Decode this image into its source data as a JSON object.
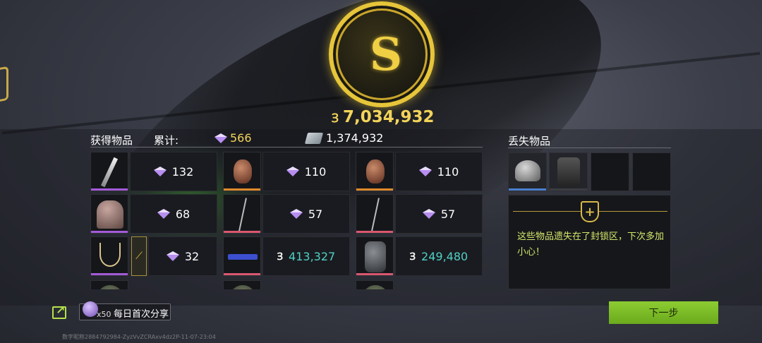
{
  "reward": {
    "currency_icon": "coin-currency-icon",
    "coin_mark": "S",
    "total": "7,034,932",
    "currency_symbol": "Ɜ"
  },
  "obtained": {
    "title": "获得物品",
    "cumulative_label": "累计:",
    "gem_total": "566",
    "cash_total": "1,374,932",
    "items": [
      {
        "icon": "knife-icon",
        "value": "132",
        "kind": "gem",
        "rarity": "#a35ad8"
      },
      {
        "icon": "jug-icon",
        "value": "110",
        "kind": "gem",
        "rarity": "#e08a2a"
      },
      {
        "icon": "jug-icon",
        "value": "110",
        "kind": "gem",
        "rarity": "#e08a2a"
      },
      {
        "icon": "statue-icon",
        "value": "68",
        "kind": "gem",
        "rarity": "#a35ad8"
      },
      {
        "icon": "rod-icon",
        "value": "57",
        "kind": "gem",
        "rarity": "#d8576e"
      },
      {
        "icon": "rod-icon",
        "value": "57",
        "kind": "gem",
        "rarity": "#d8576e"
      },
      {
        "icon": "necklace-icon",
        "value": "32",
        "kind": "gem",
        "rarity": "#a35ad8"
      },
      {
        "icon": "rifle-icon",
        "value": "413,327",
        "kind": "cash",
        "rarity": "#d8576e"
      },
      {
        "icon": "backpack-icon",
        "value": "249,480",
        "kind": "cash",
        "rarity": "#d8576e"
      }
    ]
  },
  "lost": {
    "title": "丢失物品",
    "message": "这些物品遗失在了封锁区，下次多加小心！",
    "slots": [
      {
        "icon": "helmet-icon",
        "rarity": "#4a7fd0"
      },
      {
        "icon": "vest-icon",
        "rarity": "#3a3c42"
      },
      {
        "icon": "",
        "rarity": ""
      },
      {
        "icon": "",
        "rarity": ""
      }
    ]
  },
  "share": {
    "count": "x50",
    "label": "每日首次分享"
  },
  "next_button": "下一步",
  "watermark": "数字昵称2884792984-ZyzVvZCRAxv4dz2P-11-07-23:04",
  "colors": {
    "gold": "#f3d45a",
    "cash": "#4fd1c5",
    "button": "#7cbc28",
    "warn_text": "#d4e86a"
  }
}
